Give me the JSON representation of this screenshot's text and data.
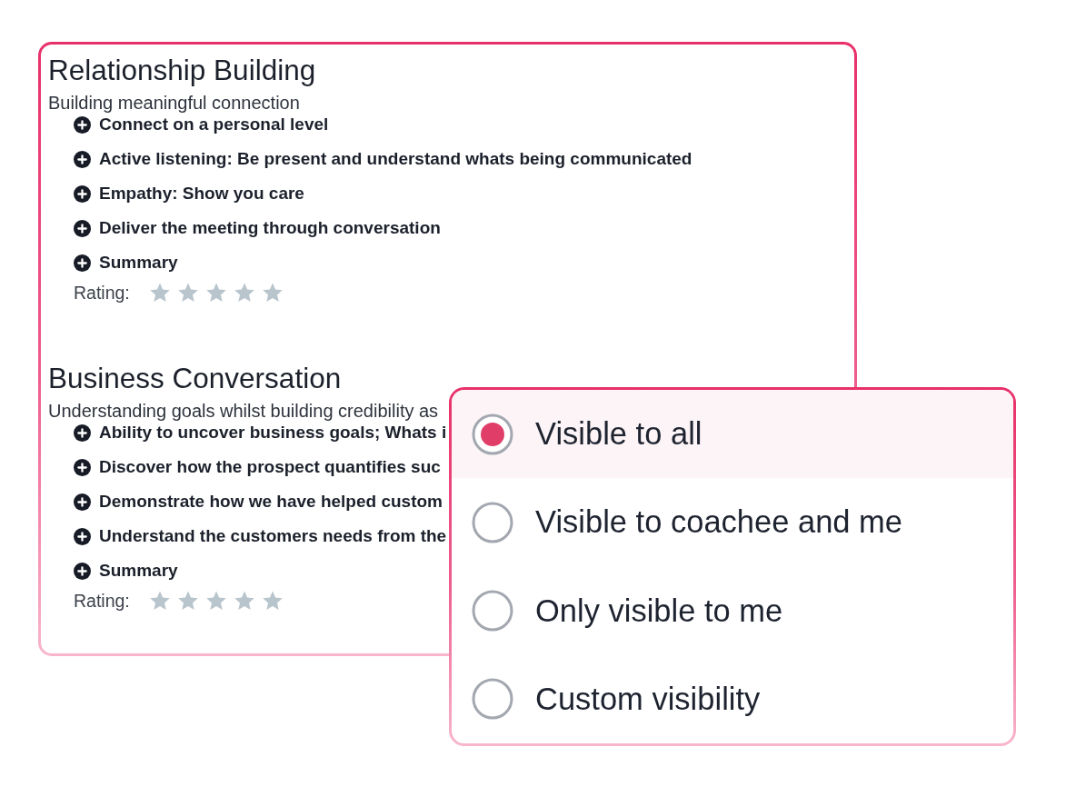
{
  "sections": [
    {
      "title": "Relationship Building",
      "subtitle": "Building meaningful connection",
      "items": [
        "Connect on a personal level",
        "Active listening: Be present and understand whats being communicated",
        "Empathy: Show you care",
        "Deliver the meeting through conversation",
        "Summary"
      ],
      "rating": {
        "label": "Rating:",
        "stars": 0
      }
    },
    {
      "title": "Business Conversation",
      "subtitle": "Understanding goals whilst building credibility as",
      "items": [
        "Ability to uncover business goals; Whats i",
        "Discover how the prospect quantifies suc",
        "Demonstrate how we have helped custom",
        "Understand the customers needs from the",
        "Summary"
      ],
      "rating": {
        "label": "Rating:",
        "stars": 0
      }
    }
  ],
  "visibility_menu": {
    "options": [
      {
        "label": "Visible to all",
        "selected": true
      },
      {
        "label": "Visible to coachee and me",
        "selected": false
      },
      {
        "label": "Only visible to me",
        "selected": false
      },
      {
        "label": "Custom visibility",
        "selected": false
      }
    ]
  }
}
